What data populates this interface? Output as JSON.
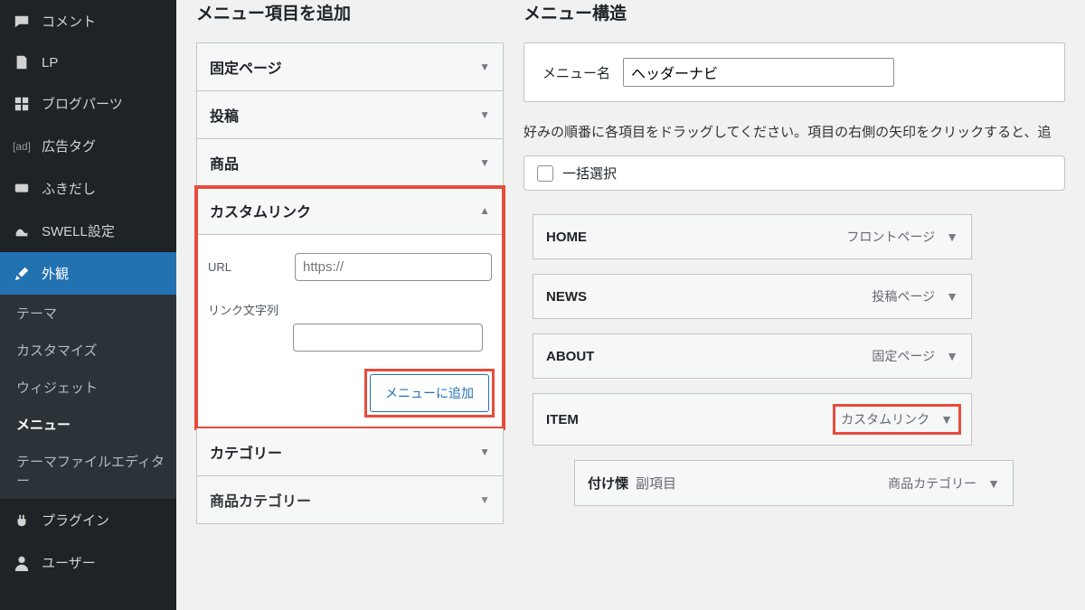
{
  "sidebar": {
    "items": [
      {
        "icon": "comment",
        "label": "コメント"
      },
      {
        "icon": "page",
        "label": "LP"
      },
      {
        "icon": "grid",
        "label": "ブログパーツ"
      },
      {
        "icon": "ad",
        "label": "広告タグ"
      },
      {
        "icon": "speech",
        "label": "ふきだし"
      },
      {
        "icon": "blob",
        "label": "SWELL設定"
      },
      {
        "icon": "brush",
        "label": "外観",
        "current": true
      },
      {
        "icon": "plug",
        "label": "プラグイン"
      },
      {
        "icon": "user",
        "label": "ユーザー"
      }
    ],
    "submenu": [
      "テーマ",
      "カスタマイズ",
      "ウィジェット",
      "メニュー",
      "テーマファイルエディター"
    ],
    "submenu_current": "メニュー"
  },
  "left": {
    "heading": "メニュー項目を追加",
    "accordions": [
      {
        "title": "固定ページ",
        "open": false
      },
      {
        "title": "投稿",
        "open": false
      },
      {
        "title": "商品",
        "open": false
      },
      {
        "title": "カスタムリンク",
        "open": true,
        "fields": {
          "url_label": "URL",
          "url_placeholder": "https://",
          "text_label": "リンク文字列",
          "submit": "メニューに追加"
        }
      },
      {
        "title": "カテゴリー",
        "open": false
      },
      {
        "title": "商品カテゴリー",
        "open": false
      }
    ]
  },
  "right": {
    "heading": "メニュー構造",
    "menu_name_label": "メニュー名",
    "menu_name_value": "ヘッダーナビ",
    "instruction": "好みの順番に各項目をドラッグしてください。項目の右側の矢印をクリックすると、追",
    "bulk_label": "一括選択",
    "menu_items": [
      {
        "title": "HOME",
        "type": "フロントページ",
        "depth": 0
      },
      {
        "title": "NEWS",
        "type": "投稿ページ",
        "depth": 0
      },
      {
        "title": "ABOUT",
        "type": "固定ページ",
        "depth": 0
      },
      {
        "title": "ITEM",
        "type": "カスタムリンク",
        "depth": 0,
        "highlight_type": true
      },
      {
        "title": "付け慄",
        "sublabel": "副項目",
        "type": "商品カテゴリー",
        "depth": 1
      }
    ]
  }
}
